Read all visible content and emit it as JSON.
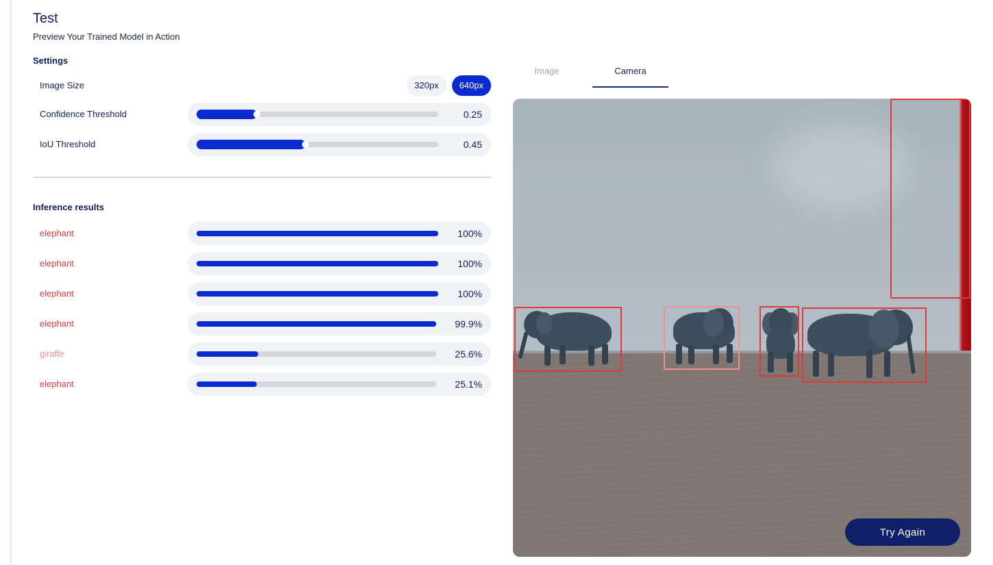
{
  "header": {
    "title": "Test",
    "subtitle": "Preview Your Trained Model in Action"
  },
  "settings": {
    "section_label": "Settings",
    "image_size": {
      "label": "Image Size",
      "options": [
        "320px",
        "640px"
      ],
      "selected": "640px"
    },
    "confidence": {
      "label": "Confidence Threshold",
      "value": 0.25,
      "value_text": "0.25"
    },
    "iou": {
      "label": "IoU Threshold",
      "value": 0.45,
      "value_text": "0.45"
    }
  },
  "results": {
    "section_label": "Inference results",
    "items": [
      {
        "label": "elephant",
        "score": 1.0,
        "score_text": "100%"
      },
      {
        "label": "elephant",
        "score": 1.0,
        "score_text": "100%"
      },
      {
        "label": "elephant",
        "score": 1.0,
        "score_text": "100%"
      },
      {
        "label": "elephant",
        "score": 0.999,
        "score_text": "99.9%"
      },
      {
        "label": "giraffe",
        "score": 0.256,
        "score_text": "25.6%"
      },
      {
        "label": "elephant",
        "score": 0.251,
        "score_text": "25.1%"
      }
    ]
  },
  "tabs": {
    "image": "Image",
    "camera": "Camera",
    "active": "camera"
  },
  "camera": {
    "try_again_label": "Try Again"
  },
  "colors": {
    "accent": "#0b2bd0",
    "navy": "#0f1f6a",
    "detection": "#e0393a",
    "detection_faint": "#f08f8f"
  }
}
